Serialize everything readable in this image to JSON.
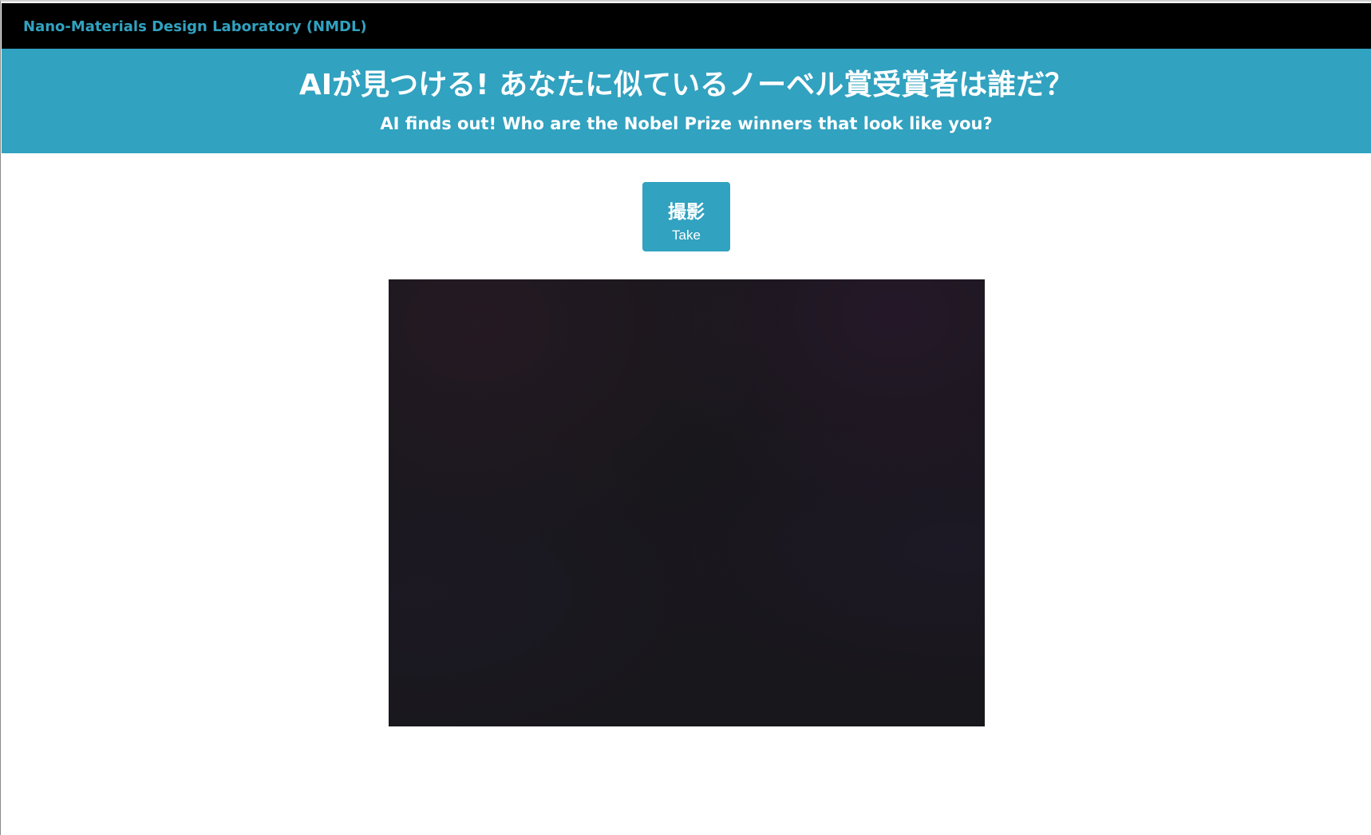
{
  "navbar": {
    "brand": "Nano-Materials Design Laboratory (NMDL)"
  },
  "hero": {
    "title": "AIが見つける! あなたに似ているノーベル賞受賞者は誰だ？",
    "subtitle": "AI finds out! Who are the Nobel Prize winners that look like you?"
  },
  "capture": {
    "label_ja": "撮影",
    "label_en": "Take"
  },
  "colors": {
    "accent": "#31a2c0",
    "navbar_bg": "#000000",
    "camera_bg": "#18171b"
  }
}
